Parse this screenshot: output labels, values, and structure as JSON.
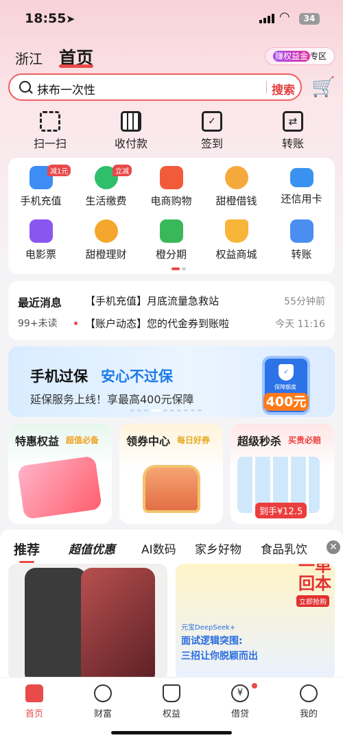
{
  "status": {
    "time": "18:55",
    "battery": "34"
  },
  "header": {
    "province": "浙江",
    "home": "首页",
    "promo_a": "赚权益金",
    "promo_b": "专区"
  },
  "search": {
    "query": "抹布一次性",
    "button": "搜索"
  },
  "quick": [
    {
      "label": "扫一扫",
      "icon": "scan-icon"
    },
    {
      "label": "收付款",
      "icon": "qr-code-icon"
    },
    {
      "label": "签到",
      "icon": "calendar-check-icon"
    },
    {
      "label": "转账",
      "icon": "transfer-icon"
    }
  ],
  "services": [
    {
      "label": "手机充值",
      "icon": "phone-topup-icon",
      "color": "#3d8df5",
      "tag": "减1元"
    },
    {
      "label": "生活缴费",
      "icon": "bolt-icon",
      "color": "#2fbf6b",
      "tag": "立减"
    },
    {
      "label": "电商购物",
      "icon": "shopping-bag-icon",
      "color": "#f25b3a",
      "tag": ""
    },
    {
      "label": "甜橙借钱",
      "icon": "borrow-coin-icon",
      "color": "#f6a93b",
      "tag": ""
    },
    {
      "label": "还信用卡",
      "icon": "credit-card-icon",
      "color": "#3a92f0",
      "tag": ""
    },
    {
      "label": "电影票",
      "icon": "movie-icon",
      "color": "#8a56f0",
      "tag": ""
    },
    {
      "label": "甜橙理财",
      "icon": "yuan-coin-icon",
      "color": "#f4a62d",
      "tag": ""
    },
    {
      "label": "橙分期",
      "icon": "installment-icon",
      "color": "#39b85a",
      "tag": ""
    },
    {
      "label": "权益商城",
      "icon": "crown-icon",
      "color": "#f7b53a",
      "tag": ""
    },
    {
      "label": "转账",
      "icon": "transfer-card-icon",
      "color": "#4a8ff0",
      "tag": ""
    }
  ],
  "news": {
    "title": "最近消息",
    "unread": "99+未读",
    "msg1": "【手机充值】月底流量急救站",
    "time1": "55分钟前",
    "msg2": "【账户动态】您的代金券到账啦",
    "time2": "今天 11:16"
  },
  "banner": {
    "title_a": "手机过保",
    "title_b": "安心不过保",
    "desc": "延保服务上线！享最高400元保障",
    "phone_text": "保障额度",
    "price": "400元"
  },
  "cards": [
    {
      "title": "特惠权益",
      "sub": "超值必备",
      "sub_color": "#f0a020"
    },
    {
      "title": "领券中心",
      "sub": "每日好券",
      "sub_color": "#e5a91a"
    },
    {
      "title": "超级秒杀",
      "sub": "买贵必赔",
      "sub_color": "#ee4040",
      "price": "到手¥12.5"
    }
  ],
  "feed_tabs": [
    "推荐",
    "超值优惠",
    "AI数码",
    "家乡好物",
    "食品乳饮"
  ],
  "ad": {
    "line1": "一单",
    "line2": "回本",
    "cta": "立即抢购",
    "brand": "元宝DeepSeek+",
    "head1": "面试逻辑突围:",
    "head2": "三招让你脱颖而出"
  },
  "nav": [
    {
      "label": "首页",
      "icon": "home-icon",
      "active": true
    },
    {
      "label": "财富",
      "icon": "wealth-icon",
      "active": false
    },
    {
      "label": "权益",
      "icon": "rights-icon",
      "active": false
    },
    {
      "label": "借贷",
      "icon": "loan-icon",
      "active": false
    },
    {
      "label": "我的",
      "icon": "profile-icon",
      "active": false
    }
  ],
  "colors": {
    "accent": "#e94a4a",
    "blue": "#1c7be8"
  }
}
